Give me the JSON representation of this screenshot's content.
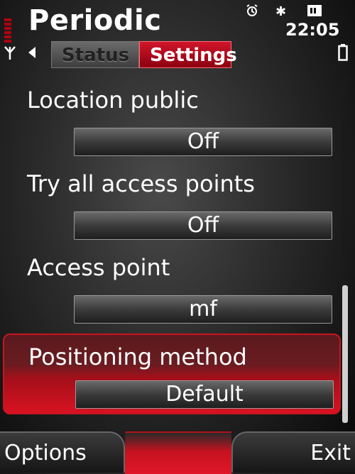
{
  "app": {
    "title": "Periodic"
  },
  "status": {
    "time": "22:05",
    "bluetooth_icon": "bluetooth-icon",
    "alarm_icon": "alarm-icon",
    "sim_icon": "sim-icon",
    "battery_icon": "battery-icon",
    "signal_icon": "signal-strength-icon"
  },
  "tabs": [
    {
      "label": "Status",
      "active": false
    },
    {
      "label": "Settings",
      "active": true
    }
  ],
  "settings": [
    {
      "label": "Location public",
      "value": "Off",
      "selected": false
    },
    {
      "label": "Try all access points",
      "value": "Off",
      "selected": false
    },
    {
      "label": "Access point",
      "value": "mf",
      "selected": false
    },
    {
      "label": "Positioning method",
      "value": "Default",
      "selected": true
    }
  ],
  "softkeys": {
    "left": "Options",
    "right": "Exit"
  },
  "colors": {
    "accent": "#d0152a",
    "background": "#2a2a2a"
  }
}
